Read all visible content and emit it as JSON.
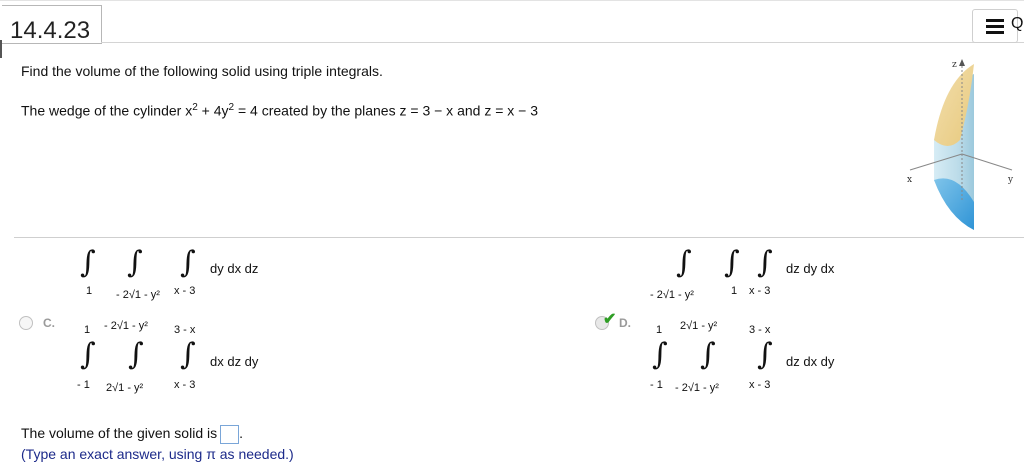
{
  "header": {
    "section": "14.4.23",
    "menu_letter": "Q"
  },
  "question": {
    "prompt": "Find the volume of the following solid using triple integrals.",
    "problem_a": "The wedge of the cylinder x",
    "problem_b": " + 4y",
    "problem_c": " = 4 created by the planes z = 3 − x and z = x − 3",
    "exp": "2"
  },
  "figure": {
    "z_label": "z",
    "x_label": "x",
    "y_label": "y"
  },
  "options": {
    "top_left": {
      "lower_outer": "1",
      "lower_mid": "- 2√1 - y²",
      "lower_inner": "x - 3",
      "differential": "dy dx dz"
    },
    "top_right": {
      "lower_mid": "- 2√1 - y²",
      "lower_inner_a": "1",
      "lower_inner_b": "x - 3",
      "differential": "dz dy dx"
    },
    "c": {
      "label": "C.",
      "upper_outer": "1",
      "upper_mid": "- 2√1 - y²",
      "upper_inner": "3 - x",
      "lower_outer": "- 1",
      "lower_mid": "2√1 - y²",
      "lower_inner": "x - 3",
      "differential": "dx dz dy"
    },
    "d": {
      "label": "D.",
      "upper_outer": "1",
      "upper_mid": "2√1 - y²",
      "upper_inner": "3 - x",
      "lower_outer": "- 1",
      "lower_mid": "- 2√1 - y²",
      "lower_inner": "x - 3",
      "differential": "dz dx dy"
    }
  },
  "answer": {
    "label": "The volume of the given solid is",
    "period": ".",
    "hint": "(Type an exact answer, using π as needed.)"
  },
  "colors": {
    "check": "#2f9e25",
    "answer_box_border": "#7aa6d8",
    "hint_text": "#1c2a8a"
  }
}
